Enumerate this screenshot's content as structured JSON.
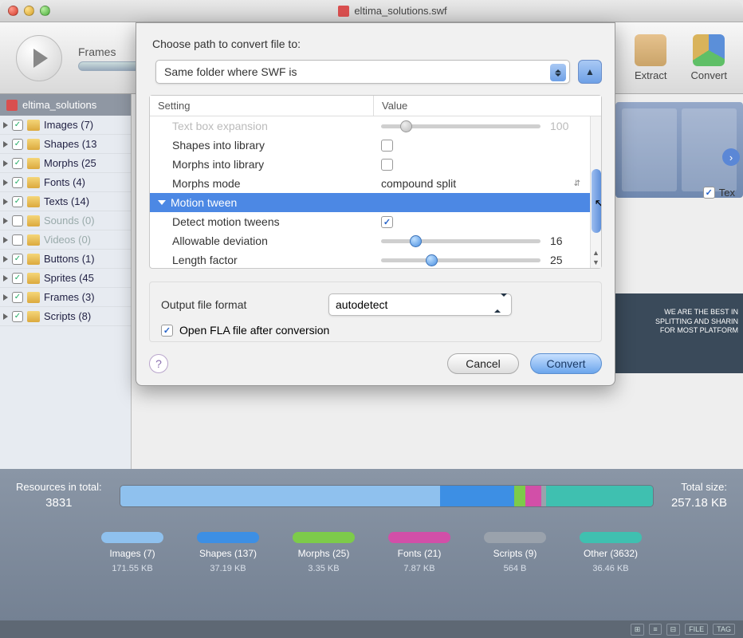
{
  "titlebar": {
    "title": "eltima_solutions.swf"
  },
  "toolbar": {
    "frames_label": "Frames",
    "extract_label": "Extract",
    "convert_label": "Convert"
  },
  "sidebar": {
    "root": "eltima_solutions",
    "items": [
      {
        "label": "Images (7)",
        "checked": true,
        "muted": false
      },
      {
        "label": "Shapes (13",
        "checked": true,
        "muted": false
      },
      {
        "label": "Morphs (25",
        "checked": true,
        "muted": false
      },
      {
        "label": "Fonts (4)",
        "checked": true,
        "muted": false
      },
      {
        "label": "Texts (14)",
        "checked": true,
        "muted": false
      },
      {
        "label": "Sounds (0)",
        "checked": false,
        "muted": true
      },
      {
        "label": "Videos (0)",
        "checked": false,
        "muted": true
      },
      {
        "label": "Buttons (1)",
        "checked": true,
        "muted": false
      },
      {
        "label": "Sprites (45",
        "checked": true,
        "muted": false
      },
      {
        "label": "Frames (3)",
        "checked": true,
        "muted": false
      },
      {
        "label": "Scripts (8)",
        "checked": true,
        "muted": false
      }
    ]
  },
  "thumbs": {
    "tex_label": "Tex"
  },
  "video_overlay": {
    "line1": "WE ARE THE BEST IN",
    "line2": "SPLITTING AND SHARIN",
    "line3": "FOR MOST PLATFORM"
  },
  "footer": {
    "resources_label": "Resources in total:",
    "resources_value": "3831",
    "total_label": "Total size:",
    "total_value": "257.18 KB",
    "legend": [
      {
        "name": "Images (7)",
        "size": "171.55 KB",
        "color": "#8fc1ee"
      },
      {
        "name": "Shapes (137)",
        "size": "37.19 KB",
        "color": "#3d8fe4"
      },
      {
        "name": "Morphs (25)",
        "size": "3.35 KB",
        "color": "#7dcb4a"
      },
      {
        "name": "Fonts (21)",
        "size": "7.87 KB",
        "color": "#d24fa8"
      },
      {
        "name": "Scripts (9)",
        "size": "564 B",
        "color": "#9aa2ac"
      },
      {
        "name": "Other (3632)",
        "size": "36.46 KB",
        "color": "#3fc0b0"
      }
    ],
    "bar_segments": [
      {
        "color": "#8fc1ee",
        "pct": 60
      },
      {
        "color": "#3d8fe4",
        "pct": 14
      },
      {
        "color": "#7dcb4a",
        "pct": 2
      },
      {
        "color": "#d24fa8",
        "pct": 3
      },
      {
        "color": "#9aa2ac",
        "pct": 1
      },
      {
        "color": "#3fc0b0",
        "pct": 20
      }
    ]
  },
  "status": {
    "file": "FILE",
    "tag": "TAG"
  },
  "dialog": {
    "choose_label": "Choose path to convert file to:",
    "path_option": "Same folder where SWF is",
    "columns": {
      "setting": "Setting",
      "value": "Value"
    },
    "rows": {
      "textbox": {
        "label": "Text box expansion",
        "value": "100",
        "knob_pct": 12
      },
      "shapeslib": {
        "label": "Shapes into library"
      },
      "morphslib": {
        "label": "Morphs into library"
      },
      "morphsmode": {
        "label": "Morphs mode",
        "value": "compound split"
      },
      "group": {
        "label": "Motion tween"
      },
      "detect": {
        "label": "Detect motion tweens"
      },
      "deviation": {
        "label": "Allowable deviation",
        "value": "16",
        "knob_pct": 18
      },
      "length": {
        "label": "Length factor",
        "value": "25",
        "knob_pct": 28
      }
    },
    "output_label": "Output file format",
    "output_value": "autodetect",
    "open_after": "Open FLA file after conversion",
    "cancel": "Cancel",
    "convert": "Convert",
    "help": "?"
  }
}
